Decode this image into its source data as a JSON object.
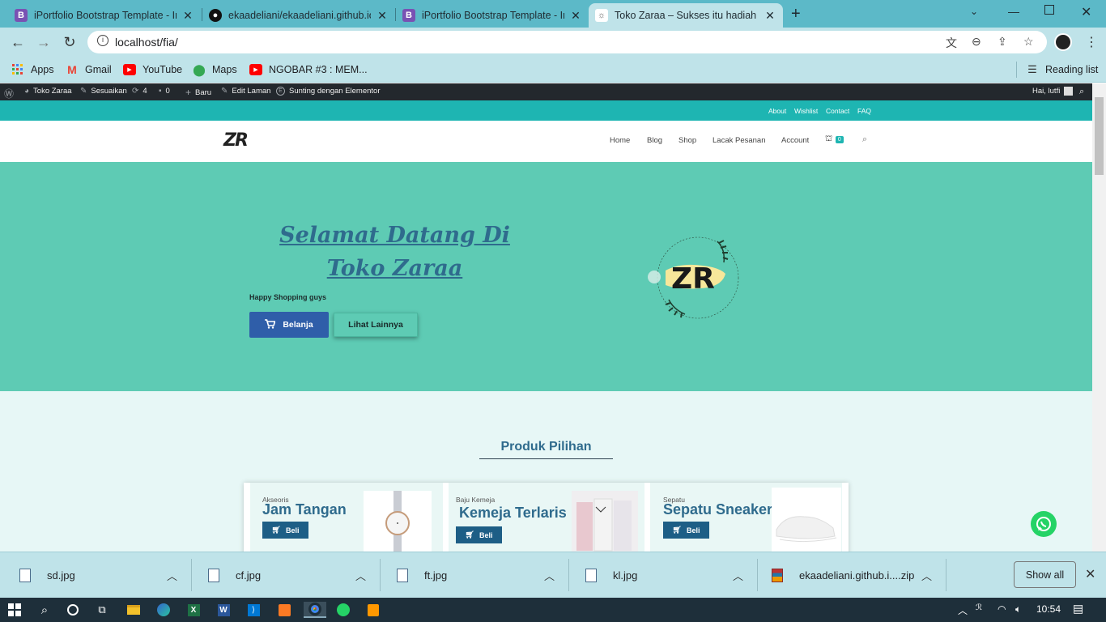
{
  "browser": {
    "tabs": [
      {
        "title": "iPortfolio Bootstrap Template - In",
        "icon": "bootstrap-icon"
      },
      {
        "title": "ekaadeliani/ekaadeliani.github.io",
        "icon": "github-icon"
      },
      {
        "title": "iPortfolio Bootstrap Template - In",
        "icon": "bootstrap-icon"
      },
      {
        "title": "Toko Zaraa – Sukses itu hadiah b",
        "icon": "site-icon",
        "active": true
      }
    ],
    "new_tab": "+",
    "url": "localhost/fia/",
    "bookmarks": [
      {
        "label": "Apps",
        "icon": "apps-grid-icon"
      },
      {
        "label": "Gmail",
        "icon": "gmail-icon"
      },
      {
        "label": "YouTube",
        "icon": "youtube-icon"
      },
      {
        "label": "Maps",
        "icon": "maps-icon"
      },
      {
        "label": "NGOBAR #3 : MEM...",
        "icon": "youtube-icon"
      }
    ],
    "reading_list": "Reading list"
  },
  "wpbar": {
    "site": "Toko Zaraa",
    "customize": "Sesuaikan",
    "updates": "4",
    "comments": "0",
    "new": "Baru",
    "edit": "Edit Laman",
    "elementor": "Sunting dengan Elementor",
    "greeting": "Hai, lutfi"
  },
  "site": {
    "toplinks": [
      "About",
      "Wishlist",
      "Contact",
      "FAQ"
    ],
    "logo": "ZR",
    "nav": [
      "Home",
      "Blog",
      "Shop",
      "Lacak Pesanan",
      "Account"
    ],
    "cart_count": "0",
    "hero": {
      "title": "Selamat Datang Di Toko Zaraa",
      "subtitle": "Happy Shopping guys",
      "btn_primary": "Belanja",
      "btn_secondary": "Lihat Lainnya",
      "logo_text": "ZR"
    },
    "section_title": "Produk Pilihan",
    "products": [
      {
        "category": "Akseoris",
        "name": "Jam Tangan",
        "button": "Beli"
      },
      {
        "category": "Baju Kemeja",
        "name": "Kemeja Terlaris",
        "button": "Beli"
      },
      {
        "category": "Sepatu",
        "name": "Sepatu Sneakers",
        "button": "Beli"
      }
    ]
  },
  "downloads": {
    "items": [
      "sd.jpg",
      "cf.jpg",
      "ft.jpg",
      "kl.jpg",
      "ekaadeliani.github.i....zip"
    ],
    "show_all": "Show all"
  },
  "taskbar": {
    "time": "10:54"
  },
  "colors": {
    "tabbar": "#5cb9c8",
    "toolbar": "#bfe3e9",
    "teal_topbar": "#1eb5b2",
    "hero_bg": "#5ecbb4",
    "accent_blue": "#2f6b8d",
    "btn_blue": "#2f5ea9"
  }
}
